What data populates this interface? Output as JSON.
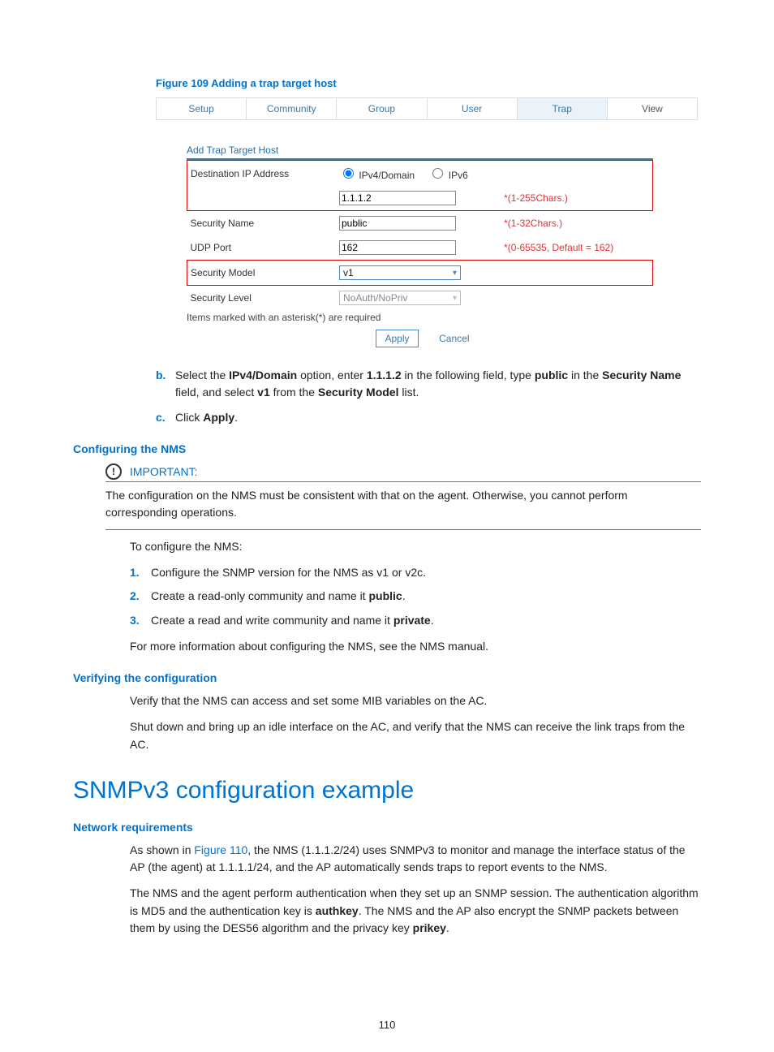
{
  "figure_title": "Figure 109 Adding a trap target host",
  "tabs": [
    "Setup",
    "Community",
    "Group",
    "User",
    "Trap",
    "View"
  ],
  "active_tab_index": 4,
  "form": {
    "header": "Add Trap Target Host",
    "dest_ip_label": "Destination IP Address",
    "radio_ipv4": "IPv4/Domain",
    "radio_ipv6": "IPv6",
    "dest_ip_value": "1.1.1.2",
    "dest_ip_hint": "*(1-255Chars.)",
    "secname_label": "Security Name",
    "secname_value": "public",
    "secname_hint": "*(1-32Chars.)",
    "udp_label": "UDP Port",
    "udp_value": "162",
    "udp_hint": "*(0-65535, Default = 162)",
    "secmodel_label": "Security Model",
    "secmodel_value": "v1",
    "seclevel_label": "Security Level",
    "seclevel_value": "NoAuth/NoPriv",
    "note": "Items marked with an asterisk(*) are required",
    "btn_apply": "Apply",
    "btn_cancel": "Cancel"
  },
  "steps": {
    "b_bul": "b.",
    "b_prefix": "Select the ",
    "b_bold1": "IPv4/Domain",
    "b_mid1": " option, enter ",
    "b_bold2": "1.1.1.2",
    "b_mid2": " in the following field, type ",
    "b_bold3": "public",
    "b_mid3": " in the ",
    "b_bold4": "Security Name",
    "b_mid4": " field, and select ",
    "b_bold5": "v1",
    "b_mid5": " from the ",
    "b_bold6": "Security Model",
    "b_mid6": " list.",
    "c_bul": "c.",
    "c_prefix": "Click ",
    "c_bold": "Apply",
    "c_suffix": "."
  },
  "section_config_nms": "Configuring the NMS",
  "important_label": "IMPORTANT:",
  "important_body": "The configuration on the NMS must be consistent with that on the agent. Otherwise, you cannot perform corresponding operations.",
  "nms_intro": "To configure the NMS:",
  "nms1_num": "1.",
  "nms1_txt": "Configure the SNMP version for the NMS as v1 or v2c.",
  "nms2_num": "2.",
  "nms2_pre": "Create a read-only community and name it ",
  "nms2_bold": "public",
  "nms2_suf": ".",
  "nms3_num": "3.",
  "nms3_pre": "Create a read and write community and name it ",
  "nms3_bold": "private",
  "nms3_suf": ".",
  "nms_more": "For more information about configuring the NMS, see the NMS manual.",
  "section_verify": "Verifying the configuration",
  "verify1": "Verify that the NMS can access and set some MIB variables on the AC.",
  "verify2": "Shut down and bring up an idle interface on the AC, and verify that the NMS can receive the link traps from the AC.",
  "h1": "SNMPv3 configuration example",
  "section_netreq": "Network requirements",
  "netreq_p1_pre": "As shown in ",
  "netreq_p1_link": "Figure 110",
  "netreq_p1_post": ", the NMS (1.1.1.2/24) uses SNMPv3 to monitor and manage the interface status of the AP (the agent) at 1.1.1.1/24, and the AP automatically sends traps to report events to the NMS.",
  "netreq_p2_pre": "The NMS and the agent perform authentication when they set up an SNMP session. The authentication algorithm is MD5 and the authentication key is ",
  "netreq_p2_b1": "authkey",
  "netreq_p2_mid": ". The NMS and the AP also encrypt the SNMP packets between them by using the DES56 algorithm and the privacy key ",
  "netreq_p2_b2": "prikey",
  "netreq_p2_suf": ".",
  "page_number": "110"
}
